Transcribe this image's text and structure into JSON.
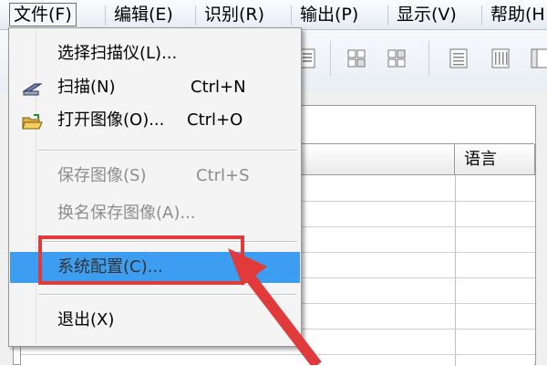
{
  "menubar": {
    "items": [
      {
        "label": "文件(F)",
        "active": true
      },
      {
        "label": "编辑(E)"
      },
      {
        "label": "识别(R)"
      },
      {
        "label": "输出(P)"
      },
      {
        "label": "显示(V)"
      },
      {
        "label": "帮助(H"
      }
    ]
  },
  "toolbar": {
    "icons": [
      "page-icon",
      "grid-icon",
      "grid-plus-icon",
      "text-block-icon",
      "columns-icon",
      "frame-icon"
    ]
  },
  "table": {
    "headers": [
      "",
      "语言"
    ]
  },
  "file_menu": {
    "items": [
      {
        "label": "选择扫描仪(L)...",
        "shortcut": "",
        "icon": "",
        "state": "normal"
      },
      {
        "label": "扫描(N)",
        "shortcut": "Ctrl+N",
        "icon": "scanner-icon",
        "state": "normal"
      },
      {
        "label": "打开图像(O)...",
        "shortcut": "Ctrl+O",
        "icon": "open-folder-icon",
        "state": "normal"
      },
      {
        "label": "保存图像(S)",
        "shortcut": "Ctrl+S",
        "icon": "",
        "state": "disabled"
      },
      {
        "label": "换名保存图像(A)...",
        "shortcut": "",
        "icon": "",
        "state": "disabled"
      },
      {
        "label": "系统配置(C)...",
        "shortcut": "",
        "icon": "",
        "state": "highlighted"
      },
      {
        "label": "退出(X)",
        "shortcut": "",
        "icon": "",
        "state": "normal"
      }
    ]
  },
  "colors": {
    "highlight": "#3d9df1",
    "annotation_red": "#e03a3a",
    "disabled_text": "#8d8d8d"
  }
}
